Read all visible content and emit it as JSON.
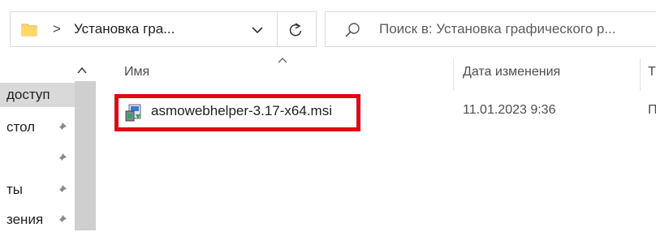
{
  "address_bar": {
    "separator": ">",
    "path": "Установка гра...",
    "icons": {
      "folder": "folder-icon",
      "dropdown": "chevron-down-icon",
      "refresh": "refresh-icon"
    }
  },
  "search": {
    "placeholder": "Поиск в: Установка графического р...",
    "icon": "search-icon"
  },
  "nav_pane": {
    "items": [
      {
        "label": "доступ",
        "pinned": false,
        "selected": true
      },
      {
        "label": "стол",
        "pinned": true,
        "selected": false
      },
      {
        "label": "",
        "pinned": true,
        "selected": false
      },
      {
        "label": "ты",
        "pinned": true,
        "selected": false
      },
      {
        "label": "зения",
        "pinned": true,
        "selected": false
      }
    ]
  },
  "columns": {
    "name": "Имя",
    "date": "Дата изменения",
    "type": "Т"
  },
  "files": [
    {
      "name": "asmowebhelper-3.17-x64.msi",
      "modified": "11.01.2023 9:36",
      "type": "П",
      "icon": "msi-installer-icon",
      "highlighted": true
    }
  ],
  "colors": {
    "highlight_border": "#e30613",
    "selected_nav": "#d9d9d9"
  }
}
